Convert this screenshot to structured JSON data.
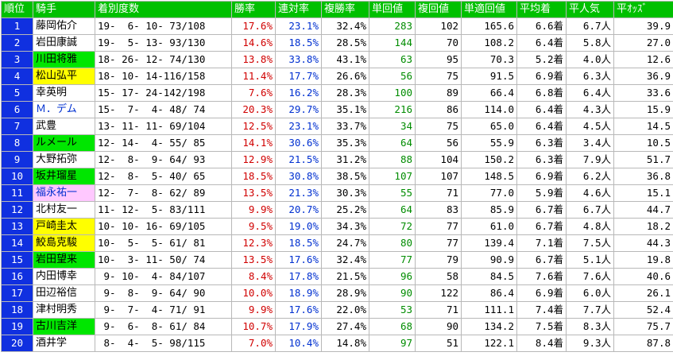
{
  "headers": [
    "順位",
    "騎手",
    "着別度数",
    "勝率",
    "連対率",
    "複勝率",
    "単回値",
    "複回値",
    "単適回値",
    "平均着",
    "平人気",
    "平ｵｯｽﾞ"
  ],
  "rows": [
    {
      "rank": "1",
      "name": "藤岡佑介",
      "hl": "",
      "rec": "19-  6- 10- 73/108",
      "win": "17.6%",
      "ren": "23.1%",
      "fuku": "32.4%",
      "tan": "283",
      "fukukai": "102",
      "tekikai": "165.6",
      "avg": "6.6着",
      "ninki": "6.7人",
      "odds": "39.9"
    },
    {
      "rank": "2",
      "name": "岩田康誠",
      "hl": "",
      "rec": "19-  5- 13- 93/130",
      "win": "14.6%",
      "ren": "18.5%",
      "fuku": "28.5%",
      "tan": "144",
      "fukukai": "70",
      "tekikai": "108.2",
      "avg": "6.4着",
      "ninki": "5.8人",
      "odds": "27.0"
    },
    {
      "rank": "3",
      "name": "川田将雅",
      "hl": "green",
      "rec": "18- 26- 12- 74/130",
      "win": "13.8%",
      "ren": "33.8%",
      "fuku": "43.1%",
      "tan": "63",
      "fukukai": "95",
      "tekikai": "70.3",
      "avg": "5.2着",
      "ninki": "4.0人",
      "odds": "12.6"
    },
    {
      "rank": "4",
      "name": "松山弘平",
      "hl": "yellow",
      "rec": "18- 10- 14-116/158",
      "win": "11.4%",
      "ren": "17.7%",
      "fuku": "26.6%",
      "tan": "56",
      "fukukai": "75",
      "tekikai": "91.5",
      "avg": "6.9着",
      "ninki": "6.3人",
      "odds": "36.9"
    },
    {
      "rank": "5",
      "name": "幸英明",
      "hl": "",
      "rec": "15- 17- 24-142/198",
      "win": "7.6%",
      "ren": "16.2%",
      "fuku": "28.3%",
      "tan": "100",
      "fukukai": "89",
      "tekikai": "66.4",
      "avg": "6.8着",
      "ninki": "6.4人",
      "odds": "33.6"
    },
    {
      "rank": "6",
      "name": "Ｍ．デム",
      "hl": "blue",
      "rec": "15-  7-  4- 48/ 74",
      "win": "20.3%",
      "ren": "29.7%",
      "fuku": "35.1%",
      "tan": "216",
      "fukukai": "86",
      "tekikai": "114.0",
      "avg": "6.4着",
      "ninki": "4.3人",
      "odds": "15.9"
    },
    {
      "rank": "7",
      "name": "武豊",
      "hl": "",
      "rec": "13- 11- 11- 69/104",
      "win": "12.5%",
      "ren": "23.1%",
      "fuku": "33.7%",
      "tan": "34",
      "fukukai": "75",
      "tekikai": "65.0",
      "avg": "6.4着",
      "ninki": "4.5人",
      "odds": "14.5"
    },
    {
      "rank": "8",
      "name": "ルメール",
      "hl": "green",
      "rec": "12- 14-  4- 55/ 85",
      "win": "14.1%",
      "ren": "30.6%",
      "fuku": "35.3%",
      "tan": "64",
      "fukukai": "56",
      "tekikai": "55.9",
      "avg": "6.3着",
      "ninki": "3.4人",
      "odds": "10.5"
    },
    {
      "rank": "9",
      "name": "大野拓弥",
      "hl": "",
      "rec": "12-  8-  9- 64/ 93",
      "win": "12.9%",
      "ren": "21.5%",
      "fuku": "31.2%",
      "tan": "88",
      "fukukai": "104",
      "tekikai": "150.2",
      "avg": "6.3着",
      "ninki": "7.9人",
      "odds": "51.7"
    },
    {
      "rank": "10",
      "name": "坂井瑠星",
      "hl": "green",
      "rec": "12-  8-  5- 40/ 65",
      "win": "18.5%",
      "ren": "30.8%",
      "fuku": "38.5%",
      "tan": "107",
      "fukukai": "107",
      "tekikai": "148.5",
      "avg": "6.9着",
      "ninki": "6.2人",
      "odds": "36.8"
    },
    {
      "rank": "11",
      "name": "福永祐一",
      "hl": "pink",
      "rec": "12-  7-  8- 62/ 89",
      "win": "13.5%",
      "ren": "21.3%",
      "fuku": "30.3%",
      "tan": "55",
      "fukukai": "71",
      "tekikai": "77.0",
      "avg": "5.9着",
      "ninki": "4.6人",
      "odds": "15.1"
    },
    {
      "rank": "12",
      "name": "北村友一",
      "hl": "",
      "rec": "11- 12-  5- 83/111",
      "win": "9.9%",
      "ren": "20.7%",
      "fuku": "25.2%",
      "tan": "64",
      "fukukai": "83",
      "tekikai": "85.9",
      "avg": "6.7着",
      "ninki": "6.7人",
      "odds": "44.7"
    },
    {
      "rank": "13",
      "name": "戸崎圭太",
      "hl": "yellow",
      "rec": "10- 10- 16- 69/105",
      "win": "9.5%",
      "ren": "19.0%",
      "fuku": "34.3%",
      "tan": "72",
      "fukukai": "77",
      "tekikai": "61.0",
      "avg": "6.7着",
      "ninki": "4.8人",
      "odds": "18.2"
    },
    {
      "rank": "14",
      "name": "鮫島克駿",
      "hl": "yellow",
      "rec": "10-  5-  5- 61/ 81",
      "win": "12.3%",
      "ren": "18.5%",
      "fuku": "24.7%",
      "tan": "80",
      "fukukai": "77",
      "tekikai": "139.4",
      "avg": "7.1着",
      "ninki": "7.5人",
      "odds": "44.3"
    },
    {
      "rank": "15",
      "name": "岩田望来",
      "hl": "green",
      "rec": "10-  3- 11- 50/ 74",
      "win": "13.5%",
      "ren": "17.6%",
      "fuku": "32.4%",
      "tan": "77",
      "fukukai": "79",
      "tekikai": "90.9",
      "avg": "6.7着",
      "ninki": "5.1人",
      "odds": "19.8"
    },
    {
      "rank": "16",
      "name": "内田博幸",
      "hl": "",
      "rec": " 9- 10-  4- 84/107",
      "win": "8.4%",
      "ren": "17.8%",
      "fuku": "21.5%",
      "tan": "96",
      "fukukai": "58",
      "tekikai": "84.5",
      "avg": "7.6着",
      "ninki": "7.6人",
      "odds": "40.6"
    },
    {
      "rank": "17",
      "name": "田辺裕信",
      "hl": "",
      "rec": " 9-  8-  9- 64/ 90",
      "win": "10.0%",
      "ren": "18.9%",
      "fuku": "28.9%",
      "tan": "90",
      "fukukai": "122",
      "tekikai": "86.4",
      "avg": "6.9着",
      "ninki": "6.0人",
      "odds": "26.1"
    },
    {
      "rank": "18",
      "name": "津村明秀",
      "hl": "",
      "rec": " 9-  7-  4- 71/ 91",
      "win": "9.9%",
      "ren": "17.6%",
      "fuku": "22.0%",
      "tan": "53",
      "fukukai": "71",
      "tekikai": "111.1",
      "avg": "7.4着",
      "ninki": "7.7人",
      "odds": "52.4"
    },
    {
      "rank": "19",
      "name": "古川吉洋",
      "hl": "green",
      "rec": " 9-  6-  8- 61/ 84",
      "win": "10.7%",
      "ren": "17.9%",
      "fuku": "27.4%",
      "tan": "68",
      "fukukai": "90",
      "tekikai": "134.2",
      "avg": "7.5着",
      "ninki": "8.3人",
      "odds": "75.7"
    },
    {
      "rank": "20",
      "name": "酒井学",
      "hl": "",
      "rec": " 8-  4-  5- 98/115",
      "win": "7.0%",
      "ren": "10.4%",
      "fuku": "14.8%",
      "tan": "97",
      "fukukai": "51",
      "tekikai": "122.1",
      "avg": "8.4着",
      "ninki": "9.3人",
      "odds": "87.8"
    }
  ]
}
